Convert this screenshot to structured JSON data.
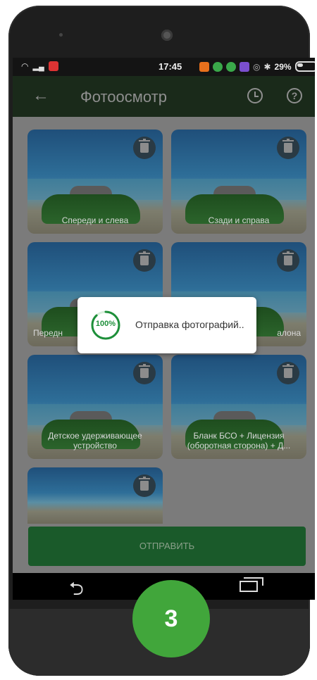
{
  "statusbar": {
    "time": "17:45",
    "battery": "29%"
  },
  "appbar": {
    "title": "Фотоосмотр"
  },
  "tiles": [
    {
      "label": "Спереди и слева"
    },
    {
      "label": "Сзади и справа"
    },
    {
      "label": "Передн"
    },
    {
      "label": "алона"
    },
    {
      "label": "Детское удерживающее устройство"
    },
    {
      "label": "Бланк БСО + Лицензия (оборотная сторона) + Д..."
    },
    {
      "label": ""
    }
  ],
  "send_button": {
    "label": "ОТПРАВИТЬ"
  },
  "dialog": {
    "percent": "100%",
    "message": "Отправка фотографий.."
  },
  "badge": {
    "number": "3"
  },
  "colors": {
    "accent_green": "#1e8f3a",
    "badge_green": "#41a63b"
  },
  "upload_progress": 1.0
}
